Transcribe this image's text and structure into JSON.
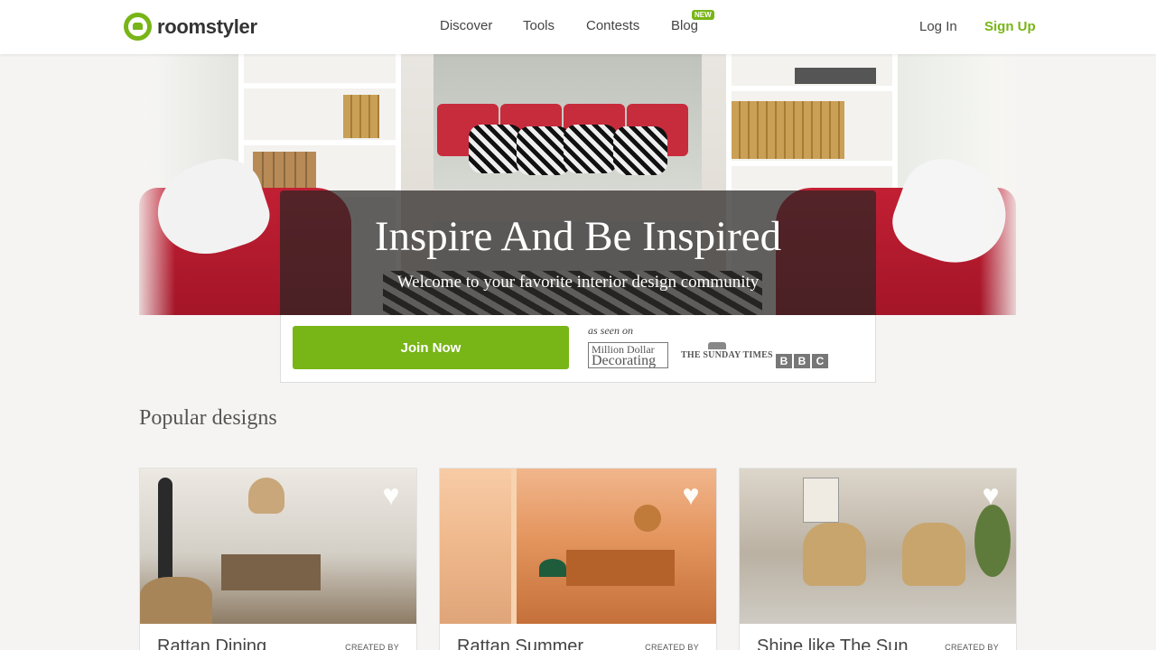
{
  "brand": {
    "name": "roomstyler",
    "accent": "#78b517"
  },
  "nav": {
    "items": [
      {
        "label": "Discover"
      },
      {
        "label": "Tools"
      },
      {
        "label": "Contests"
      },
      {
        "label": "Blog",
        "badge": "NEW"
      }
    ],
    "login": "Log In",
    "signup": "Sign Up"
  },
  "hero": {
    "title": "Inspire And Be Inspired",
    "subtitle": "Welcome to your favorite interior design community",
    "cta": "Join Now",
    "seen_on": "as seen on",
    "media": {
      "mdd_line1": "Million Dollar",
      "mdd_line2": "Decorating",
      "times": "THE SUNDAY TIMES",
      "bbc": [
        "B",
        "B",
        "C"
      ]
    }
  },
  "popular": {
    "title": "Popular designs",
    "cards": [
      {
        "name": "Rattan Dining",
        "created_by": "CREATED BY"
      },
      {
        "name": "Rattan Summer",
        "created_by": "CREATED BY"
      },
      {
        "name": "Shine like The Sun",
        "created_by": "CREATED BY"
      }
    ]
  },
  "icons": {
    "favorite": "heart-icon",
    "logo": "armchair-logo-icon"
  }
}
